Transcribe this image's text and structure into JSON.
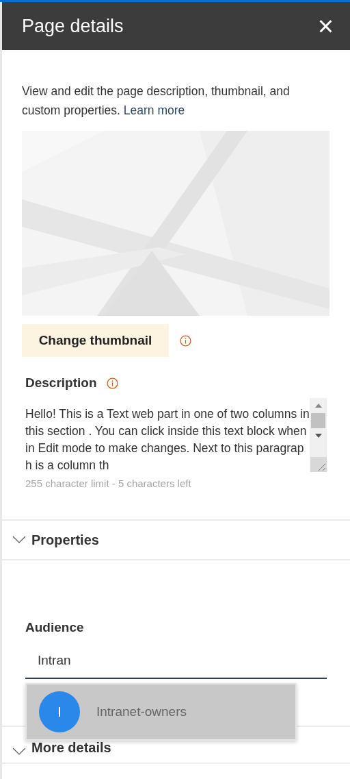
{
  "header": {
    "title": "Page details",
    "close": "×"
  },
  "intro": {
    "text": "View and edit the page description, thumbnail, and custom properties.",
    "link": "Learn more"
  },
  "change_thumbnail": {
    "label": "Change thumbnail"
  },
  "description": {
    "label": "Description",
    "value": "Hello! This is a Text web part in one of two columns in this section . You can click inside this text block when in Edit mode to make changes. Next to this paragraph is a column th",
    "limit": "255 character limit - 5 characters left"
  },
  "sections": [
    {
      "title": "Properties"
    },
    {
      "title": "More details"
    }
  ],
  "audience": {
    "label": "Audience",
    "value": "Intran"
  },
  "suggestions": [
    {
      "initial": "I",
      "name": "Intranet-owners",
      "selected": true
    }
  ]
}
